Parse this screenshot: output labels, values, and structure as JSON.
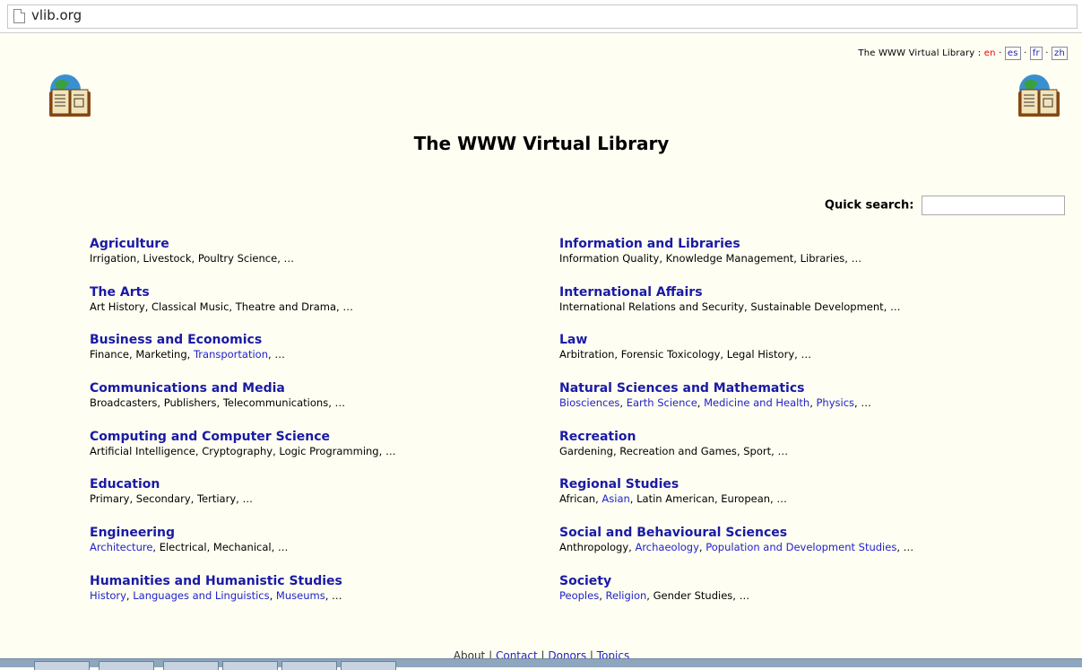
{
  "browser": {
    "url": "vlib.org"
  },
  "lang_bar": {
    "label": "The WWW Virtual Library :",
    "current": "en",
    "options": [
      "es",
      "fr",
      "zh"
    ],
    "sep": "·"
  },
  "title": "The WWW Virtual Library",
  "search": {
    "label": "Quick search:",
    "value": ""
  },
  "categories_left": [
    {
      "title": "Agriculture",
      "subs": [
        {
          "text": "Irrigation",
          "link": false
        },
        {
          "text": "Livestock",
          "link": false
        },
        {
          "text": "Poultry Science",
          "link": false
        }
      ]
    },
    {
      "title": "The Arts",
      "subs": [
        {
          "text": "Art History",
          "link": false
        },
        {
          "text": "Classical Music",
          "link": false
        },
        {
          "text": "Theatre and Drama",
          "link": false
        }
      ]
    },
    {
      "title": "Business and Economics",
      "subs": [
        {
          "text": "Finance",
          "link": false
        },
        {
          "text": "Marketing",
          "link": false
        },
        {
          "text": "Transportation",
          "link": true
        }
      ]
    },
    {
      "title": "Communications and Media",
      "subs": [
        {
          "text": "Broadcasters",
          "link": false
        },
        {
          "text": "Publishers",
          "link": false
        },
        {
          "text": "Telecommunications",
          "link": false
        }
      ]
    },
    {
      "title": "Computing and Computer Science",
      "subs": [
        {
          "text": "Artificial Intelligence",
          "link": false
        },
        {
          "text": "Cryptography",
          "link": false
        },
        {
          "text": "Logic Programming",
          "link": false
        }
      ]
    },
    {
      "title": "Education",
      "subs": [
        {
          "text": "Primary",
          "link": false
        },
        {
          "text": "Secondary",
          "link": false
        },
        {
          "text": "Tertiary",
          "link": false
        }
      ]
    },
    {
      "title": "Engineering",
      "subs": [
        {
          "text": "Architecture",
          "link": true
        },
        {
          "text": "Electrical",
          "link": false
        },
        {
          "text": "Mechanical",
          "link": false
        }
      ]
    },
    {
      "title": "Humanities and Humanistic Studies",
      "subs": [
        {
          "text": "History",
          "link": true
        },
        {
          "text": "Languages and Linguistics",
          "link": true
        },
        {
          "text": "Museums",
          "link": true
        }
      ]
    }
  ],
  "categories_right": [
    {
      "title": "Information and Libraries",
      "subs": [
        {
          "text": "Information Quality",
          "link": false
        },
        {
          "text": "Knowledge Management",
          "link": false
        },
        {
          "text": "Libraries",
          "link": false
        }
      ]
    },
    {
      "title": "International Affairs",
      "subs": [
        {
          "text": "International Relations and Security",
          "link": false
        },
        {
          "text": "Sustainable Development",
          "link": false
        }
      ]
    },
    {
      "title": "Law",
      "subs": [
        {
          "text": "Arbitration",
          "link": false
        },
        {
          "text": "Forensic Toxicology",
          "link": false
        },
        {
          "text": "Legal History",
          "link": false
        }
      ]
    },
    {
      "title": "Natural Sciences and Mathematics",
      "subs": [
        {
          "text": "Biosciences",
          "link": true
        },
        {
          "text": "Earth Science",
          "link": true
        },
        {
          "text": "Medicine and Health",
          "link": true
        },
        {
          "text": "Physics",
          "link": true
        }
      ]
    },
    {
      "title": "Recreation",
      "subs": [
        {
          "text": "Gardening",
          "link": false
        },
        {
          "text": "Recreation and Games",
          "link": false
        },
        {
          "text": "Sport",
          "link": false
        }
      ]
    },
    {
      "title": "Regional Studies",
      "subs": [
        {
          "text": "African",
          "link": false
        },
        {
          "text": "Asian",
          "link": true
        },
        {
          "text": "Latin American",
          "link": false
        },
        {
          "text": "European",
          "link": false
        }
      ]
    },
    {
      "title": "Social and Behavioural Sciences",
      "subs": [
        {
          "text": "Anthropology",
          "link": false
        },
        {
          "text": "Archaeology",
          "link": true
        },
        {
          "text": "Population and Development Studies",
          "link": true
        }
      ]
    },
    {
      "title": "Society",
      "subs": [
        {
          "text": "Peoples",
          "link": true
        },
        {
          "text": "Religion",
          "link": true
        },
        {
          "text": "Gender Studies",
          "link": false
        }
      ]
    }
  ],
  "ellipsis": "…",
  "footer": {
    "items": [
      {
        "text": "About",
        "link": false
      },
      {
        "text": "Contact",
        "link": true
      },
      {
        "text": "Donors",
        "link": true
      },
      {
        "text": "Topics",
        "link": true
      }
    ],
    "sep": "|"
  }
}
